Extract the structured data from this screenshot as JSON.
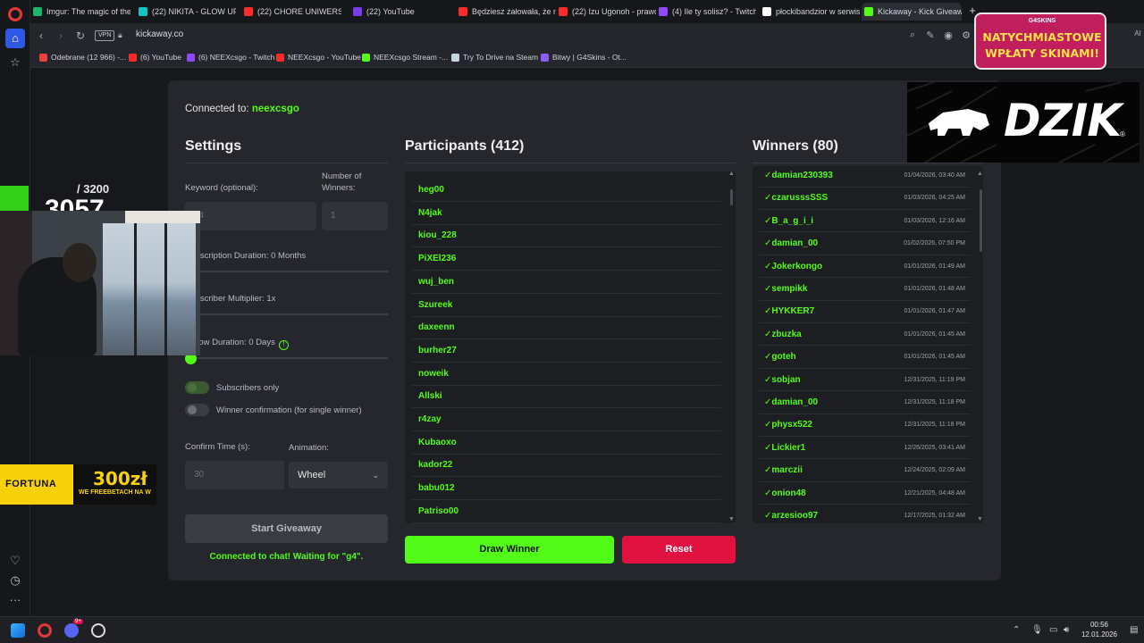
{
  "browser": {
    "tabs": [
      {
        "label": "Imgur: The magic of the In",
        "color": "#1bb76e",
        "x": 0
      },
      {
        "label": "(22) NIKITA - GLOW UP (C",
        "color": "#18c4c4",
        "x": 0
      },
      {
        "label": "(22) CHORE UNIWERSUM",
        "color": "#ff2b2b",
        "x": 0
      },
      {
        "label": "(22) YouTube",
        "color": "#7c3aed",
        "x": 0
      },
      {
        "label": "Będziesz żałowała, że nie",
        "color": "#ff2b2b",
        "x": 0
      },
      {
        "label": "(22) Izu Ugonoh - prawdz",
        "color": "#ff2b2b",
        "x": 0
      },
      {
        "label": "(4) Ile ty solisz? - Twitch",
        "color": "#9146ff",
        "x": 0
      },
      {
        "label": "płockibandzior w serwisie",
        "color": "#ffffff",
        "x": 0
      },
      {
        "label": "Kickaway - Kick Giveaway",
        "color": "#53fc18",
        "x": 0
      }
    ],
    "url": "kickaway.co",
    "vpn_label": "VPN",
    "bookmarks": [
      {
        "label": "Odebrane (12 966) -...",
        "color": "#ea4335"
      },
      {
        "label": "(6) YouTube",
        "color": "#ff2b2b"
      },
      {
        "label": "(6) NEEXcsgo - Twitch",
        "color": "#9146ff"
      },
      {
        "label": "NEEXcsgo - YouTube",
        "color": "#ff2b2b"
      },
      {
        "label": "NEEXcsgo Stream -...",
        "color": "#53fc18"
      },
      {
        "label": "Try To Drive na Steam",
        "color": "#c7d5e0"
      },
      {
        "label": "Bitwy | G4Skins - Ot...",
        "color": "#8b5cf6"
      }
    ],
    "addr_ai": "AI"
  },
  "app": {
    "connected_label": "Connected to:",
    "channel": "neexcsgo",
    "settings_title": "Settings",
    "participants_title": "Participants (412)",
    "winners_title": "Winners (80)",
    "settings": {
      "keyword_label": "Keyword (optional):",
      "keyword_value": "g4",
      "winners_label_1": "Number of",
      "winners_label_2": "Winners:",
      "winners_value": "1",
      "sub_duration": "Subscription Duration: 0 Months",
      "sub_multiplier": "Subscriber Multiplier: 1x",
      "follow_duration": "Follow Duration: 0 Days",
      "subscribers_only": "Subscribers only",
      "winner_confirmation": "Winner confirmation (for single winner)",
      "confirm_time_label": "Confirm Time (s):",
      "confirm_time_value": "30",
      "animation_label": "Animation:",
      "animation_value": "Wheel",
      "start_button": "Start Giveaway",
      "status": "Connected to chat! Waiting for \"g4\"."
    },
    "participants": [
      "heg00",
      "N4jak",
      "kiou_228",
      "PiXEl236",
      "wuj_ben",
      "Szureek",
      "daxeenn",
      "burher27",
      "noweik",
      "Allski",
      "r4zay",
      "Kubaoxo",
      "kador22",
      "babu012",
      "Patriso00"
    ],
    "winners": [
      {
        "name": "damian230393",
        "date": "01/04/2026, 03:40 AM"
      },
      {
        "name": "czarusssSSS",
        "date": "01/03/2026, 04:25 AM"
      },
      {
        "name": "B_a_g_i_i",
        "date": "01/03/2026, 12:16 AM"
      },
      {
        "name": "damian_00",
        "date": "01/02/2026, 07:50 PM"
      },
      {
        "name": "Jokerkongo",
        "date": "01/01/2026, 01:49 AM"
      },
      {
        "name": "sempikk",
        "date": "01/01/2026, 01:48 AM"
      },
      {
        "name": "HYKKER7",
        "date": "01/01/2026, 01:47 AM"
      },
      {
        "name": "zbuzka",
        "date": "01/01/2026, 01:45 AM"
      },
      {
        "name": "goteh",
        "date": "01/01/2026, 01:45 AM"
      },
      {
        "name": "sobjan",
        "date": "12/31/2025, 11:19 PM"
      },
      {
        "name": "damian_00",
        "date": "12/31/2025, 11:18 PM"
      },
      {
        "name": "physx522",
        "date": "12/31/2025, 11:18 PM"
      },
      {
        "name": "Lickier1",
        "date": "12/26/2025, 03:41 AM"
      },
      {
        "name": "marczii",
        "date": "12/24/2025, 02:09 AM"
      },
      {
        "name": "onion48",
        "date": "12/21/2025, 04:48 AM"
      },
      {
        "name": "arzesioo97",
        "date": "12/17/2025, 01:32 AM"
      }
    ],
    "check": "✓",
    "draw_button": "Draw Winner",
    "reset_button": "Reset"
  },
  "overlays": {
    "dzik": "DZIK",
    "dzik_reg": "®",
    "promo_brand": "G4SKINS",
    "promo_line1": "NATYCHMIASTOWE",
    "promo_line2": "WPŁATY SKINAMI!",
    "counter_max": "/ 3200",
    "counter_value": "3057",
    "fortuna_brand": "FORTUNA",
    "fortuna_amount": "300zł",
    "fortuna_sub": "WE FREEBETACH NA W"
  },
  "taskbar": {
    "time": "00:56",
    "date": "12.01.2026",
    "discord_badge": "9+"
  },
  "colors": {
    "accent": "#53fc18",
    "reset": "#e0103f",
    "card": "#26272c"
  }
}
